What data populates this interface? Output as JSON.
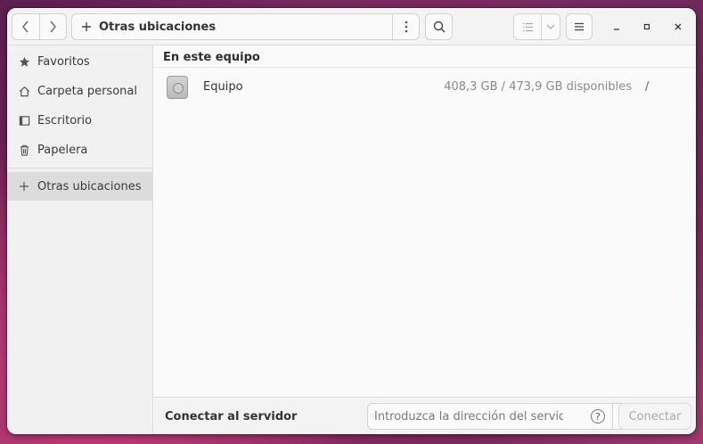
{
  "header": {
    "location": "Otras ubicaciones",
    "back_icon": "chevron-left-icon",
    "forward_icon": "chevron-right-icon"
  },
  "sidebar": {
    "items": [
      {
        "label": "Favoritos",
        "icon": "star-icon"
      },
      {
        "label": "Carpeta personal",
        "icon": "home-icon"
      },
      {
        "label": "Escritorio",
        "icon": "desktop-icon"
      },
      {
        "label": "Papelera",
        "icon": "trash-icon"
      },
      {
        "label": "Otras ubicaciones",
        "icon": "plus-icon",
        "active": true
      }
    ]
  },
  "main": {
    "section_title": "En este equipo",
    "rows": [
      {
        "name": "Equipo",
        "space": "408,3 GB / 473,9 GB disponibles",
        "mount": "/"
      }
    ]
  },
  "connect": {
    "label": "Conectar al servidor",
    "placeholder": "Introduzca la dirección del servid…",
    "help": "?",
    "button": "Conectar"
  }
}
